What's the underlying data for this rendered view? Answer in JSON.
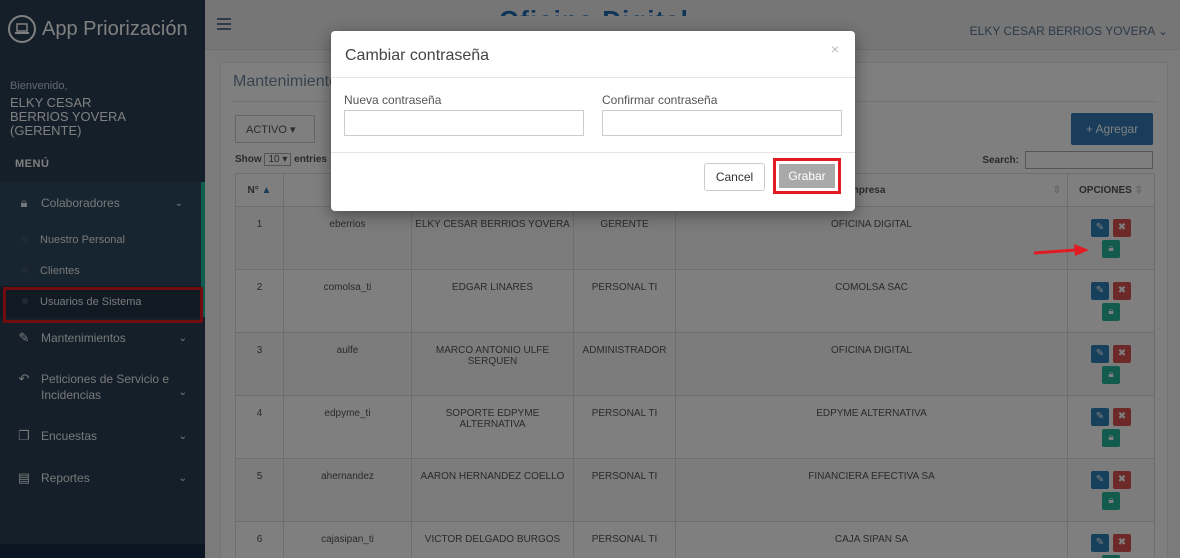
{
  "app": {
    "title": "App Priorización"
  },
  "sidebar": {
    "welcome": "Bienvenido,",
    "user": "ELKY CESAR BERRIOS YOVERA (GERENTE)",
    "menu_title": "MENÚ",
    "items": [
      {
        "label": "Colaboradores",
        "icon": "lock-icon"
      },
      {
        "label": "Mantenimientos",
        "icon": "edit-icon"
      },
      {
        "label": "Peticiones de Servicio e Incidencias",
        "icon": "reply-all-icon"
      },
      {
        "label": "Encuestas",
        "icon": "files-icon"
      },
      {
        "label": "Reportes",
        "icon": "file-text-icon"
      }
    ],
    "submenu": [
      {
        "label": "Nuestro Personal"
      },
      {
        "label": "Clientes"
      },
      {
        "label": "Usuarios de Sistema"
      }
    ]
  },
  "topbar": {
    "banner": "Oficina Digital",
    "user_label": "ELKY CESAR BERRIOS YOVERA ⌄"
  },
  "panel": {
    "title": "Mantenimiento",
    "status_value": "ACTIVO",
    "add_label": "+ Agregar",
    "show_label": "Show",
    "show_value": "10",
    "show_suffix": "entries",
    "search_label": "Search:"
  },
  "table": {
    "headers": [
      "N°",
      "",
      "",
      "",
      "Empresa",
      "OPCIONES"
    ],
    "rows": [
      {
        "n": "1",
        "user": "eberrios",
        "name": "ELKY CESAR BERRIOS YOVERA",
        "role": "GERENTE",
        "company": "OFICINA DIGITAL"
      },
      {
        "n": "2",
        "user": "comolsa_ti",
        "name": "EDGAR LINARES",
        "role": "PERSONAL TI",
        "company": "COMOLSA SAC"
      },
      {
        "n": "3",
        "user": "aulfe",
        "name": "MARCO ANTONIO ULFE SERQUEN",
        "role": "ADMINISTRADOR",
        "company": "OFICINA DIGITAL"
      },
      {
        "n": "4",
        "user": "edpyme_ti",
        "name": "SOPORTE EDPYME ALTERNATIVA",
        "role": "PERSONAL TI",
        "company": "EDPYME ALTERNATIVA"
      },
      {
        "n": "5",
        "user": "ahernandez",
        "name": "AARON HERNANDEZ COELLO",
        "role": "PERSONAL TI",
        "company": "FINANCIERA EFECTIVA SA"
      },
      {
        "n": "6",
        "user": "cajasipan_ti",
        "name": "VICTOR DELGADO BURGOS",
        "role": "PERSONAL TI",
        "company": "CAJA SIPAN SA"
      }
    ]
  },
  "modal": {
    "title": "Cambiar contraseña",
    "close": "×",
    "new_password_label": "Nueva contraseña",
    "confirm_password_label": "Confirmar contraseña",
    "cancel_label": "Cancel",
    "save_label": "Grabar"
  },
  "colors": {
    "sidebar": "#2a3f54",
    "accent": "#1abb9c",
    "highlight": "#e21b22"
  }
}
